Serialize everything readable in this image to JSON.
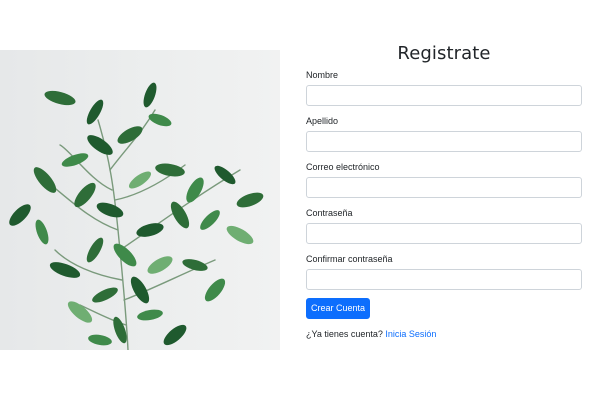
{
  "form": {
    "title": "Registrate",
    "fields": [
      {
        "label": "Nombre",
        "value": "",
        "placeholder": ""
      },
      {
        "label": "Apellido",
        "value": "",
        "placeholder": ""
      },
      {
        "label": "Correo electrónico",
        "value": "",
        "placeholder": ""
      },
      {
        "label": "Contraseña",
        "value": "",
        "placeholder": ""
      },
      {
        "label": "Confirmar contraseña",
        "value": "",
        "placeholder": ""
      }
    ],
    "submit_label": "Crear Cuenta",
    "login_prompt": "¿Ya tienes cuenta?",
    "login_link": "Inicia Sesión"
  },
  "colors": {
    "primary": "#0d6efd",
    "leaf_dark": "#1f5a2e",
    "leaf_mid": "#3f8a4a",
    "leaf_light": "#6fae72",
    "background_panel": "#eceeee"
  },
  "image": {
    "subject": "plant-branch-image"
  }
}
